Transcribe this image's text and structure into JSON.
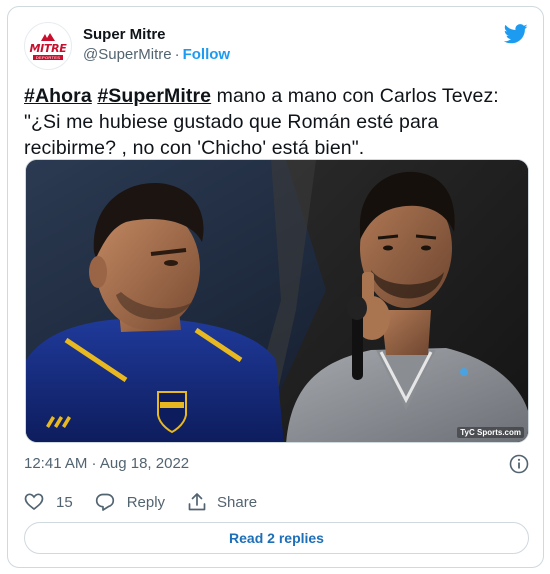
{
  "author": {
    "name": "Super Mitre",
    "handle": "@SuperMitre",
    "follow_label": "Follow",
    "avatar_brand": "MITRE",
    "avatar_sub": "DEPORTES"
  },
  "tweet": {
    "hashtag1": "#Ahora",
    "hashtag2": "#SuperMitre",
    "text": " mano a mano con Carlos Tevez: \"¿Si me hubiese gustado que Román esté para recibirme? , no con 'Chicho' está bien\"."
  },
  "media": {
    "watermark": "TyC Sports.com"
  },
  "meta": {
    "timestamp": "12:41 AM · Aug 18, 2022"
  },
  "actions": {
    "like_count": "15",
    "reply_label": "Reply",
    "share_label": "Share"
  },
  "read_replies_label": "Read 2 replies",
  "colors": {
    "twitter_blue": "#1d9bf0",
    "text_secondary": "#536471",
    "brand_red": "#c8102e",
    "border": "#cfd9de"
  }
}
